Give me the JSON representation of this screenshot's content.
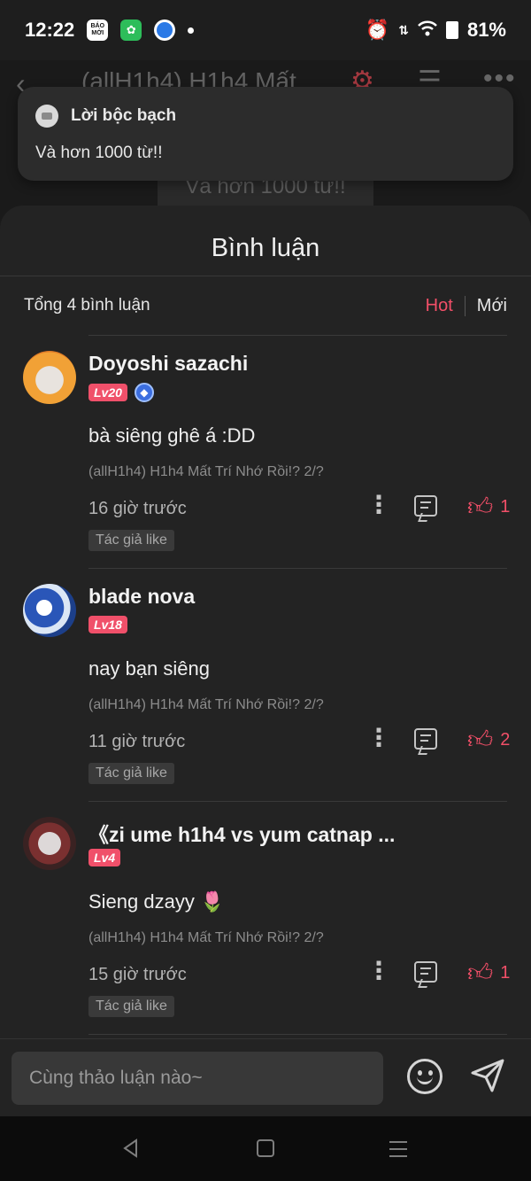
{
  "status_bar": {
    "time": "12:22",
    "battery": "81%",
    "apps": [
      "BÁO MỚI"
    ]
  },
  "background": {
    "title": "(allH1h4) H1h4 Mất",
    "quote": "Và hơn 1000 từ!!"
  },
  "notification": {
    "title": "Lời bộc bạch",
    "body": "Và hơn 1000 từ!!"
  },
  "sheet": {
    "title": "Bình luận",
    "total": "Tổng 4 bình luận",
    "sort_hot": "Hot",
    "sort_new": "Mới"
  },
  "comments": [
    {
      "name": "Doyoshi sazachi",
      "level": "Lv20",
      "text": "bà siêng ghê á :DD",
      "chapter": "(allH1h4) H1h4 Mất Trí Nhớ Rồi!? 2/?",
      "time": "16 giờ trước",
      "likes": "1",
      "author_like": "Tác giả like"
    },
    {
      "name": "blade nova",
      "level": "Lv18",
      "text": "nay bạn siêng",
      "chapter": "(allH1h4) H1h4 Mất Trí Nhớ Rồi!? 2/?",
      "time": "11 giờ trước",
      "likes": "2",
      "author_like": "Tác giả like"
    },
    {
      "name": "《zi ume h1h4 vs yum catnap ...",
      "level": "Lv4",
      "text": "Sieng dzayy 🌷",
      "chapter": "(allH1h4) H1h4 Mất Trí Nhớ Rồi!? 2/?",
      "time": "15 giờ trước",
      "likes": "1",
      "author_like": "Tác giả like"
    }
  ],
  "input": {
    "placeholder": "Cùng thảo luận nào~"
  },
  "colors": {
    "accent": "#f24f68",
    "background": "#232323"
  }
}
